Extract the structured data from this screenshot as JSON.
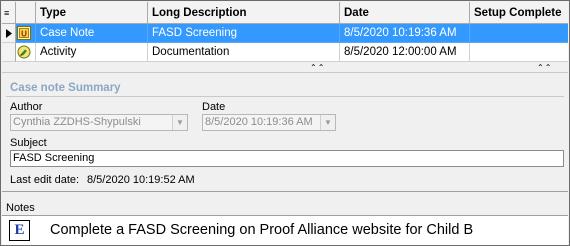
{
  "grid": {
    "columns": [
      "Type",
      "Long Description",
      "Date",
      "Setup Complete"
    ],
    "rows": [
      {
        "type": "Case Note",
        "description": "FASD Screening",
        "date": "8/5/2020 10:19:36 AM",
        "setup_complete": "",
        "icon": "case-note-icon",
        "selected": true
      },
      {
        "type": "Activity",
        "description": "Documentation",
        "date": "8/5/2020 12:00:00 AM",
        "setup_complete": "",
        "icon": "activity-icon",
        "selected": false
      }
    ]
  },
  "summary": {
    "title": "Case note Summary",
    "author_label": "Author",
    "author_value": "Cynthia ZZDHS-Shypulski",
    "date_label": "Date",
    "date_value": "8/5/2020 10:19:36 AM",
    "subject_label": "Subject",
    "subject_value": "FASD Screening",
    "last_edit_label": "Last edit date:",
    "last_edit_value": "8/5/2020 10:19:52 AM"
  },
  "notes": {
    "label": "Notes",
    "icon_letter": "E",
    "text": "Complete a FASD Screening on Proof Alliance website for Child B"
  },
  "colors": {
    "selection": "#3399ff",
    "summary_title": "#8aa8c6",
    "e_icon": "#1f3ea8"
  }
}
